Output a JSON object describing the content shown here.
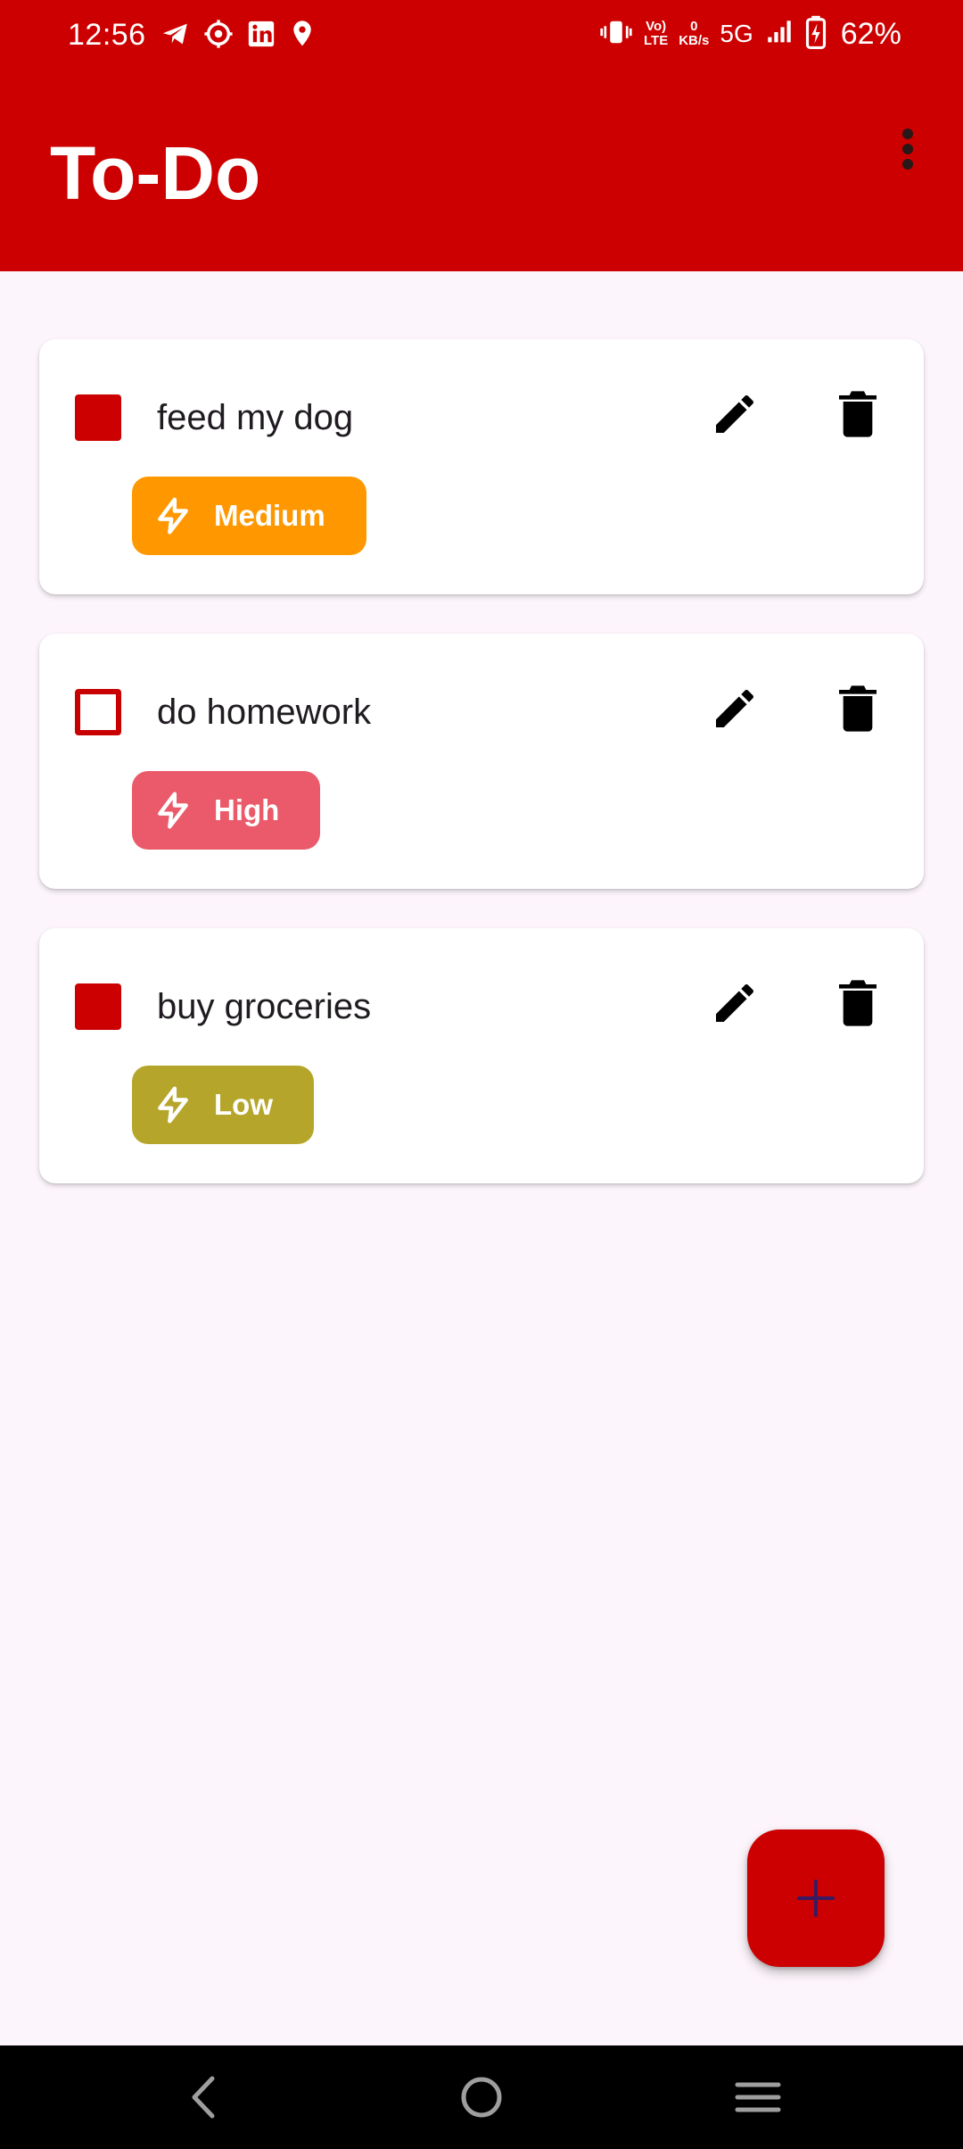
{
  "status_bar": {
    "time": "12:56",
    "data_rate_value": "0",
    "data_rate_unit": "KB/s",
    "volte_top": "Vo)",
    "volte_bottom": "LTE",
    "network": "5G",
    "battery_percent": "62%"
  },
  "app_bar": {
    "title": "To-Do",
    "menu_icon": "more-vert-icon"
  },
  "tasks": [
    {
      "title": "feed my dog",
      "checked": true,
      "priority": "Medium",
      "priority_color": "#ff9800"
    },
    {
      "title": "do homework",
      "checked": false,
      "priority": "High",
      "priority_color": "#ea5a6a"
    },
    {
      "title": "buy groceries",
      "checked": true,
      "priority": "Low",
      "priority_color": "#b5a62b"
    }
  ],
  "fab": {
    "icon": "plus-icon"
  },
  "colors": {
    "primary": "#cc0000",
    "background": "#fcf5fb",
    "fab_icon": "#3a1a60"
  }
}
